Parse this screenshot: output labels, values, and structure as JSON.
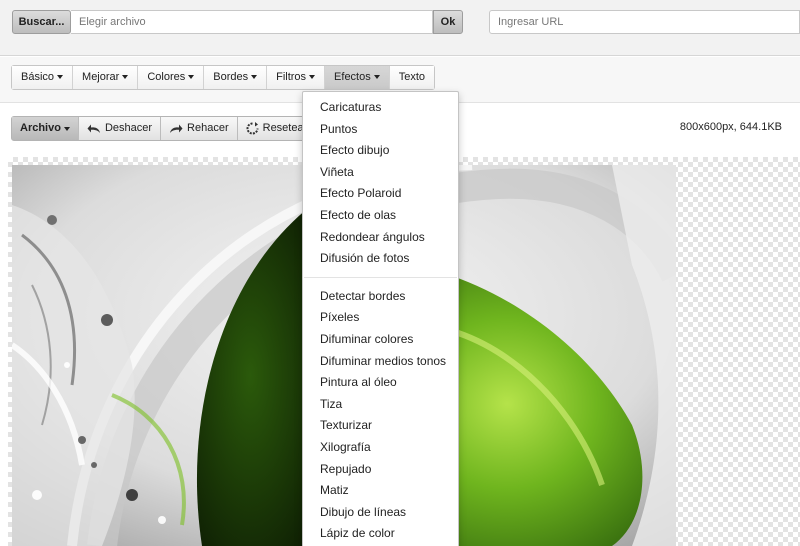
{
  "top": {
    "browse_label": "Buscar...",
    "file_placeholder": "Elegir archivo",
    "ok_label": "Ok",
    "url_placeholder": "Ingresar URL"
  },
  "menu": {
    "items": [
      "Básico",
      "Mejorar",
      "Colores",
      "Bordes",
      "Filtros",
      "Efectos",
      "Texto"
    ],
    "active": "Efectos"
  },
  "toolbar": {
    "file_label": "Archivo",
    "undo_label": "Deshacer",
    "redo_label": "Rehacer",
    "reset_label": "Resetear"
  },
  "image_info": "800x600px, 644.1KB",
  "effects_menu": {
    "group1": [
      "Caricaturas",
      "Puntos",
      "Efecto dibujo",
      "Viñeta",
      "Efecto Polaroid",
      "Efecto de olas",
      "Redondear ángulos",
      "Difusión de fotos"
    ],
    "group2": [
      "Detectar bordes",
      "Píxeles",
      "Difuminar colores",
      "Difuminar medios tonos",
      "Pintura al óleo",
      "Tiza",
      "Texturizar",
      "Xilografía",
      "Repujado",
      "Matiz",
      "Dibujo de líneas",
      "Lápiz de color"
    ]
  },
  "colors": {
    "lime_green": "#6fb51e",
    "dark_green": "#1f3d08"
  }
}
